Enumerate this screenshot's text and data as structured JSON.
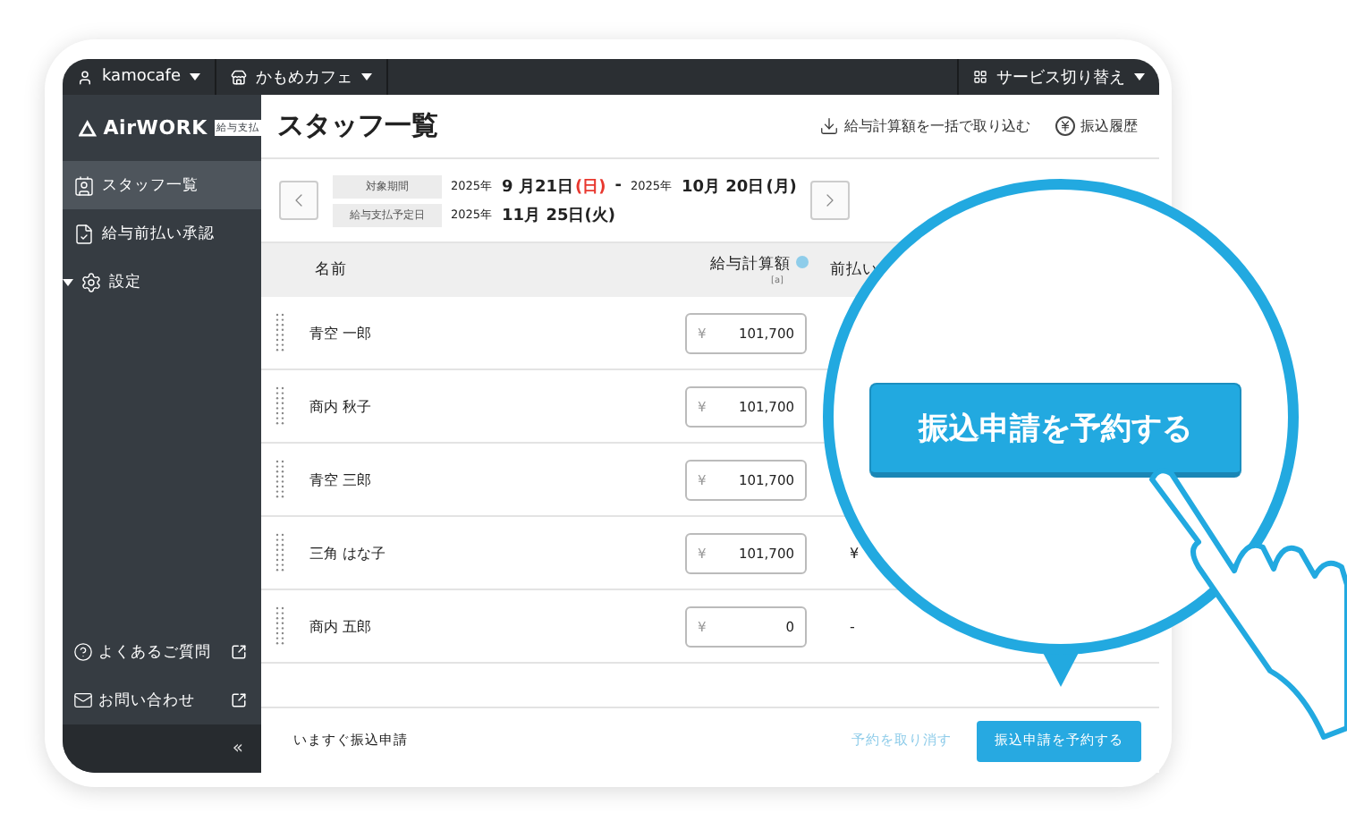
{
  "top_bar": {
    "account": "kamocafe",
    "store": "かもめカフェ",
    "service_switch": "サービス切り替え"
  },
  "sidebar": {
    "logo": "AirWORK",
    "logo_badge": "給与支払",
    "items": [
      {
        "label": "スタッフ一覧",
        "selected": true
      },
      {
        "label": "給与前払い承認",
        "selected": false
      },
      {
        "label": "設定",
        "selected": false,
        "expanded": true
      }
    ],
    "footer_links": [
      {
        "label": "よくあるご質問"
      },
      {
        "label": "お問い合わせ"
      }
    ],
    "collapse": "«"
  },
  "page": {
    "title": "スタッフ一覧",
    "actions": [
      {
        "label": "給与計算額を一括で取り込む"
      },
      {
        "label": "振込履歴"
      }
    ]
  },
  "period": {
    "label": "対象期間",
    "start": {
      "year": "2025年",
      "date": "9 月21日",
      "weekday": "(日)",
      "holiday": true
    },
    "separator": "-",
    "end": {
      "year": "2025年",
      "date": "10月 20日",
      "weekday": "(月)",
      "holiday": false
    }
  },
  "pay_date": {
    "label": "給与支払予定日",
    "year": "2025年",
    "date": "11月 25日(火)"
  },
  "table": {
    "columns": [
      {
        "label": "名前"
      },
      {
        "label": "給与計算額",
        "note": "[a]"
      },
      {
        "label": "前払い"
      }
    ],
    "rows": [
      {
        "name": "青空 一郎",
        "currency": "¥",
        "amount": "101,700"
      },
      {
        "name": "商内 秋子",
        "currency": "¥",
        "amount": "101,700"
      },
      {
        "name": "青空 三郎",
        "currency": "¥",
        "amount": "101,700"
      },
      {
        "name": "三角 はな子",
        "currency": "¥",
        "amount": "101,700",
        "advance": "¥"
      },
      {
        "name": "商内 五郎",
        "currency": "¥",
        "amount": "0",
        "advance": "-"
      }
    ]
  },
  "footer": {
    "label": "いますぐ振込申請",
    "cancel": "予約を取り消す",
    "submit": "振込申請を予約する"
  },
  "callout": {
    "button": "振込申請を予約する"
  }
}
